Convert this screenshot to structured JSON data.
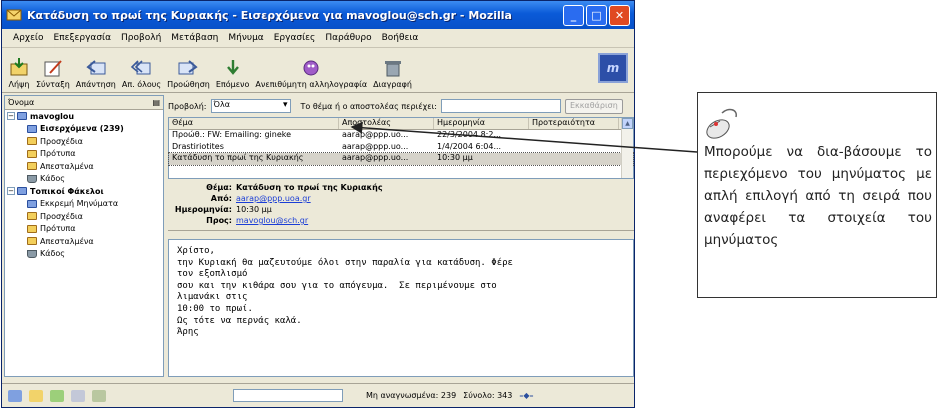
{
  "window": {
    "title": "Κατάδυση το πρωί της Κυριακής - Εισερχόμενα για mavoglou@sch.gr - Mozilla",
    "controls": [
      "_",
      "□",
      "✕"
    ]
  },
  "menubar": [
    "Αρχείο",
    "Επεξεργασία",
    "Προβολή",
    "Μετάβαση",
    "Μήνυμα",
    "Εργασίες",
    "Παράθυρο",
    "Βοήθεια"
  ],
  "toolbar": {
    "buttons": [
      {
        "label": "Λήψη",
        "icon": "get-mail-icon"
      },
      {
        "label": "Σύνταξη",
        "icon": "compose-icon"
      },
      {
        "label": "Απάντηση",
        "icon": "reply-icon"
      },
      {
        "label": "Απ. όλους",
        "icon": "reply-all-icon"
      },
      {
        "label": "Προώθηση",
        "icon": "forward-icon"
      },
      {
        "label": "Επόμενο",
        "icon": "next-icon"
      },
      {
        "label": "Ανεπιθύμητη αλληλογραφία",
        "icon": "junk-icon"
      },
      {
        "label": "Διαγραφή",
        "icon": "delete-icon"
      }
    ],
    "logo_text": "m"
  },
  "folders": {
    "header": "Όνομα",
    "accounts": [
      {
        "name": "mavoglou",
        "items": [
          {
            "label": "Εισερχόμενα (239)",
            "bold": true,
            "kind": "inbox"
          },
          {
            "label": "Προσχέδια",
            "kind": "folder"
          },
          {
            "label": "Πρότυπα",
            "kind": "folder"
          },
          {
            "label": "Απεσταλμένα",
            "kind": "folder"
          },
          {
            "label": "Κάδος",
            "kind": "trash"
          }
        ]
      },
      {
        "name": "Τοπικοί Φάκελοι",
        "items": [
          {
            "label": "Εκκρεμή Μηνύματα",
            "kind": "inbox"
          },
          {
            "label": "Προσχέδια",
            "kind": "folder"
          },
          {
            "label": "Πρότυπα",
            "kind": "folder"
          },
          {
            "label": "Απεσταλμένα",
            "kind": "folder"
          },
          {
            "label": "Κάδος",
            "kind": "trash"
          }
        ]
      }
    ]
  },
  "filter": {
    "view_label": "Προβολή:",
    "view_value": "Όλα",
    "search_label": "Το θέμα ή ο αποστολέας περιέχει:",
    "search_value": "",
    "clear_button": "Εκκαθάριση"
  },
  "message_list": {
    "columns": [
      "Θέμα",
      "Αποστολέας",
      "Ημερομηνία",
      "Προτεραιότητα"
    ],
    "rows": [
      {
        "subject": "Προώθ.: FW: Emailing: gineke",
        "sender": "aarap@ppp.uo...",
        "date": "22/3/2004 8:2...",
        "selected": false
      },
      {
        "subject": "Drastiriotites",
        "sender": "aarap@ppp.uo...",
        "date": "1/4/2004 6:04...",
        "selected": false
      },
      {
        "subject": "Κατάδυση το πρωί της Κυριακής",
        "sender": "aarap@ppp.uo...",
        "date": "10:30 μμ",
        "selected": true
      }
    ]
  },
  "message_headers": {
    "subject_label": "Θέμα:",
    "subject": "Κατάδυση το πρωί της Κυριακής",
    "from_label": "Από:",
    "from": "aarap@ppp.uoa.gr",
    "date_label": "Ημερομηνία:",
    "date": "10:30 μμ",
    "to_label": "Προς:",
    "to": "mavoglou@sch.gr"
  },
  "message_body": [
    "Χρίστο,",
    "την Κυριακή θα μαζευτούμε όλοι στην παραλία για κατάδυση. Φέρε",
    "τον εξοπλισμό",
    "σου και την κιθάρα σου για το απόγευμα.  Σε περιμένουμε στο",
    "λιμανάκι στις",
    "10:00 το πρωί.",
    "",
    "Ως τότε να περνάς καλά.",
    "Άρης"
  ],
  "statusbar": {
    "unread": "Μη αναγνωσμένα: 239",
    "total": "Σύνολο: 343"
  },
  "callout": {
    "text": "Μπορούμε να δια-βάσουμε το περιεχόμενο του μηνύματος με απλή επιλογή από τη σειρά που αναφέρει τα στοιχεία του μηνύματος"
  },
  "colors": {
    "titlebar": "#0a5ad8",
    "window_bg": "#ece9d8",
    "link": "#1b3ed6"
  }
}
